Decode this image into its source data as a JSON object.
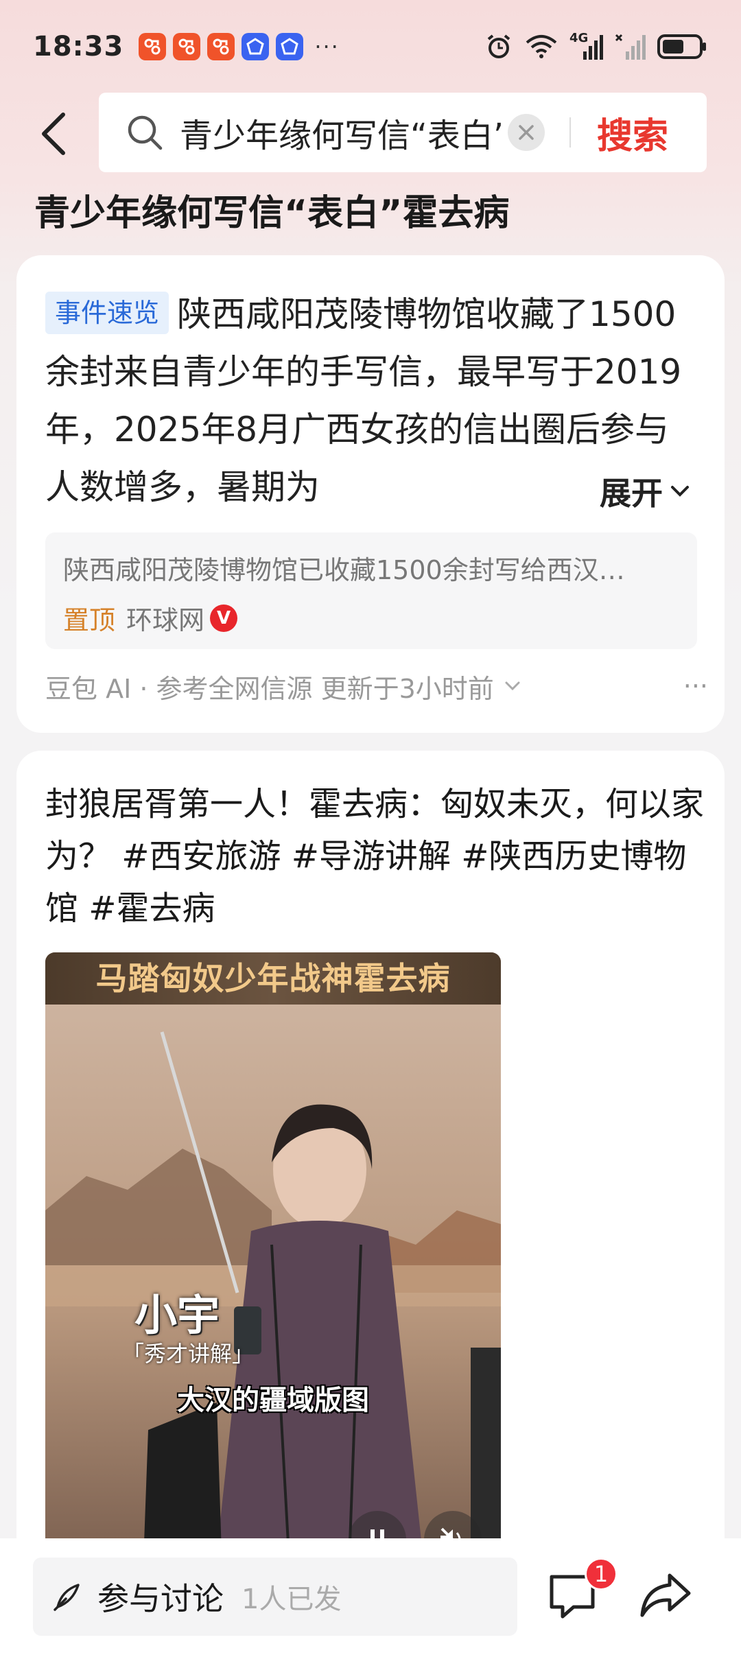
{
  "status_bar": {
    "time": "18:33",
    "more": "···",
    "notification_icons": [
      "app-orange-icon",
      "app-orange-icon",
      "app-orange-icon",
      "app-blue-icon",
      "app-blue-icon"
    ],
    "signal_label": "4G"
  },
  "search": {
    "query": "青少年缘何写信“表白”霍去病",
    "submit_label": "搜索"
  },
  "page_title": "青少年缘何写信“表白”霍去病",
  "ai_summary": {
    "tag": "事件速览",
    "text": "陕西咸阳茂陵博物馆收藏了1500余封来自青少年的手写信，最早写于2019年，2025年8月广西女孩的信出圈后参与人数增多，暑期为",
    "expand_label": "展开",
    "source": {
      "title": "陕西咸阳茂陵博物馆已收藏1500余封写给西汉…",
      "pinned_label": "置顶",
      "name": "环球网",
      "verified": "V"
    },
    "footer": "豆包 AI · 参考全网信源 更新于3小时前",
    "more": "···"
  },
  "video_post": {
    "title": "封狼居胥第一人！霍去病：匈奴未灭，何以家为？ #西安旅游 #导游讲解 #陕西历史博物馆 #霍去病",
    "banner": "马踏匈奴少年战神霍去病",
    "caption_name": "小宇",
    "caption_role": "「秀才讲解」",
    "subtitle": "大汉的疆域版图"
  },
  "bottom_bar": {
    "comment_label": "参与讨论",
    "comment_count": "1人已发",
    "badge": "1"
  },
  "colors": {
    "accent_red": "#e8382f",
    "tag_blue": "#2a6ad8",
    "pin_orange": "#d6822a"
  }
}
